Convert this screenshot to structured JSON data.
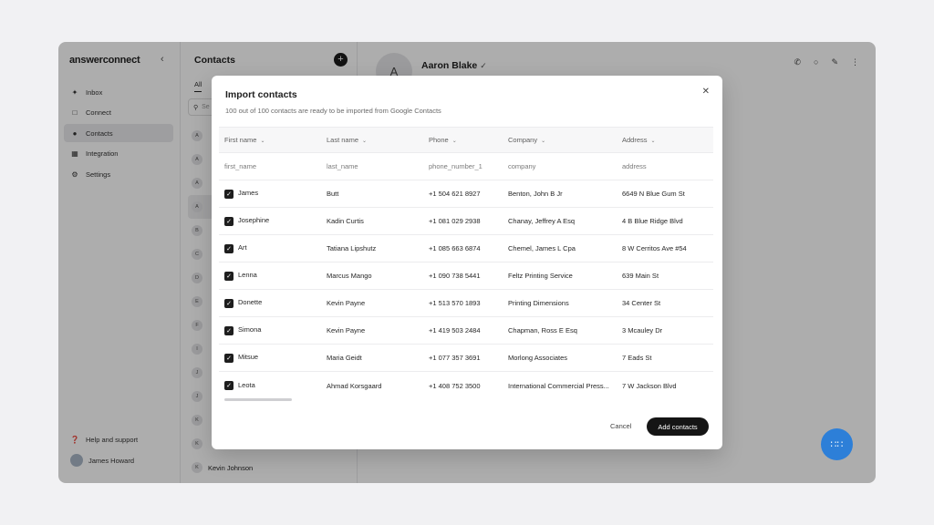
{
  "sidebar": {
    "brand_main": "answerconnect",
    "collapse_icon": "chevron-left-icon",
    "items": [
      {
        "label": "Inbox",
        "icon": "inbox-icon"
      },
      {
        "label": "Connect",
        "icon": "connect-icon"
      },
      {
        "label": "Contacts",
        "icon": "contacts-icon"
      },
      {
        "label": "Integration",
        "icon": "grid-icon"
      },
      {
        "label": "Settings",
        "icon": "gear-icon"
      }
    ],
    "active_item": "Contacts",
    "help_label": "Help and support",
    "user_name": "James Howard"
  },
  "contacts_panel": {
    "title": "Contacts",
    "tab_all": "All",
    "search_placeholder": "Se",
    "list": [
      {
        "initial": "A"
      },
      {
        "initial": "A"
      },
      {
        "initial": "A"
      },
      {
        "initial": "A"
      },
      {
        "initial": "B"
      },
      {
        "initial": "C"
      },
      {
        "initial": "D"
      },
      {
        "initial": "E"
      },
      {
        "initial": "F"
      },
      {
        "initial": "I"
      },
      {
        "initial": "J"
      },
      {
        "initial": "J"
      },
      {
        "initial": "K"
      },
      {
        "initial": "K"
      },
      {
        "initial": "K",
        "name": "Kevin Johnson"
      }
    ]
  },
  "detail": {
    "avatar_initial": "A",
    "name": "Aaron Blake"
  },
  "modal": {
    "title": "Import contacts",
    "subtitle": "100 out of 100 contacts are ready to be imported from Google Contacts",
    "columns": [
      "First name",
      "Last name",
      "Phone",
      "Company",
      "Address"
    ],
    "mapping": [
      "first_name",
      "last_name",
      "phone_number_1",
      "company",
      "address"
    ],
    "rows": [
      {
        "first": "James",
        "last": "Butt",
        "phone": "+1 504 621 8927",
        "company": "Benton, John B Jr",
        "address": "6649 N Blue Gum St"
      },
      {
        "first": "Josephine",
        "last": "Kadin Curtis",
        "phone": "+1 081 029 2938",
        "company": "Chanay, Jeffrey A Esq",
        "address": "4 B Blue Ridge Blvd"
      },
      {
        "first": "Art",
        "last": "Tatiana Lipshutz",
        "phone": "+1 085 663 6874",
        "company": "Chemel, James L Cpa",
        "address": "8 W Cerritos Ave #54"
      },
      {
        "first": "Lenna",
        "last": "Marcus Mango",
        "phone": "+1 090 738 5441",
        "company": "Feltz Printing Service",
        "address": "639 Main St"
      },
      {
        "first": "Donette",
        "last": "Kevin Payne",
        "phone": "+1 513 570 1893",
        "company": "Printing Dimensions",
        "address": "34 Center St"
      },
      {
        "first": "Simona",
        "last": "Kevin Payne",
        "phone": "+1 419 503 2484",
        "company": "Chapman, Ross E Esq",
        "address": "3 Mcauley Dr"
      },
      {
        "first": "Mitsue",
        "last": "Maria Geidt",
        "phone": "+1 077 357 3691",
        "company": "Morlong Associates",
        "address": "7 Eads St"
      },
      {
        "first": "Leota",
        "last": "Ahmad Korsgaard",
        "phone": "+1 408 752 3500",
        "company": "International Commercial Press...",
        "address": "7 W Jackson Blvd"
      }
    ],
    "cancel_label": "Cancel",
    "submit_label": "Add contacts"
  }
}
